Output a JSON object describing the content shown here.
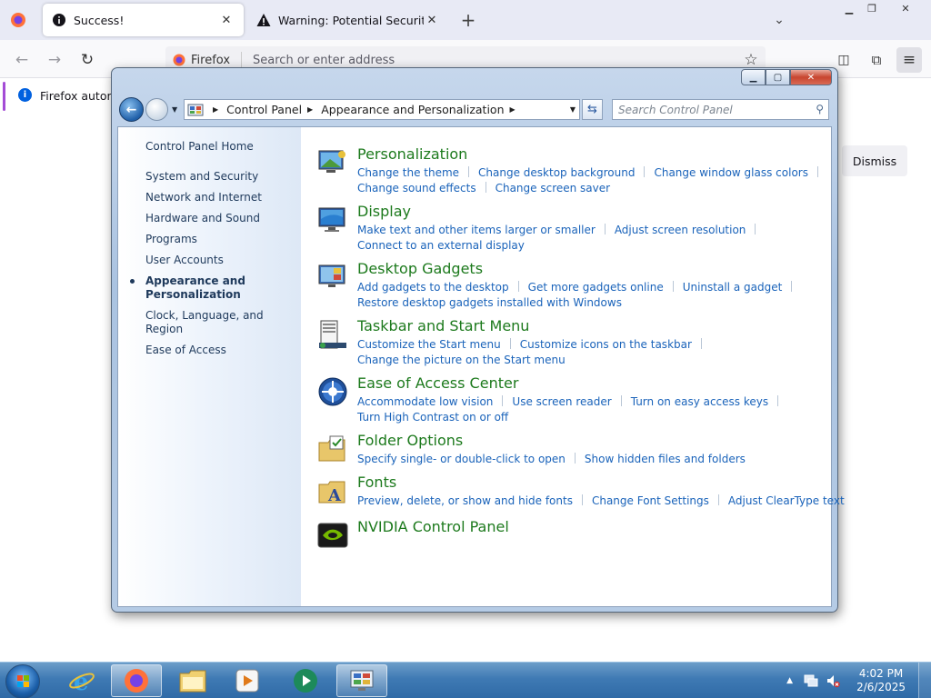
{
  "browser": {
    "tabs": [
      {
        "label": "Success!",
        "active": true,
        "icon": "info-icon"
      },
      {
        "label": "Warning: Potential Security Risk",
        "active": false,
        "icon": "warning-icon"
      }
    ],
    "new_tab_label": "+",
    "url_identity": "Firefox",
    "url_placeholder": "Search or enter address",
    "notice_text": "Firefox automa",
    "dismiss_label": "Dismiss"
  },
  "control_panel": {
    "breadcrumb": [
      "Control Panel",
      "Appearance and Personalization"
    ],
    "search_placeholder": "Search Control Panel",
    "sidebar": {
      "home": "Control Panel Home",
      "items": [
        "System and Security",
        "Network and Internet",
        "Hardware and Sound",
        "Programs",
        "User Accounts",
        "Appearance and Personalization",
        "Clock, Language, and Region",
        "Ease of Access"
      ],
      "current_index": 5
    },
    "categories": [
      {
        "title": "Personalization",
        "icon": "personalization-icon",
        "links": [
          "Change the theme",
          "Change desktop background",
          "Change window glass colors",
          "Change sound effects",
          "Change screen saver"
        ]
      },
      {
        "title": "Display",
        "icon": "display-icon",
        "links": [
          "Make text and other items larger or smaller",
          "Adjust screen resolution",
          "Connect to an external display"
        ]
      },
      {
        "title": "Desktop Gadgets",
        "icon": "gadgets-icon",
        "links": [
          "Add gadgets to the desktop",
          "Get more gadgets online",
          "Uninstall a gadget",
          "Restore desktop gadgets installed with Windows"
        ]
      },
      {
        "title": "Taskbar and Start Menu",
        "icon": "taskbar-icon",
        "links": [
          "Customize the Start menu",
          "Customize icons on the taskbar",
          "Change the picture on the Start menu"
        ]
      },
      {
        "title": "Ease of Access Center",
        "icon": "ease-of-access-icon",
        "links": [
          "Accommodate low vision",
          "Use screen reader",
          "Turn on easy access keys",
          "Turn High Contrast on or off"
        ]
      },
      {
        "title": "Folder Options",
        "icon": "folder-options-icon",
        "links": [
          "Specify single- or double-click to open",
          "Show hidden files and folders"
        ]
      },
      {
        "title": "Fonts",
        "icon": "fonts-icon",
        "links": [
          "Preview, delete, or show and hide fonts",
          "Change Font Settings",
          "Adjust ClearType text"
        ]
      },
      {
        "title": "NVIDIA Control Panel",
        "icon": "nvidia-icon",
        "links": []
      }
    ]
  },
  "taskbar": {
    "clock_time": "4:02 PM",
    "clock_date": "2/6/2025"
  },
  "colors": {
    "category_title": "#1d7a1d",
    "link": "#1a63ba",
    "sidebar_text": "#1e395b",
    "taskbar": "#3f7ab4"
  }
}
